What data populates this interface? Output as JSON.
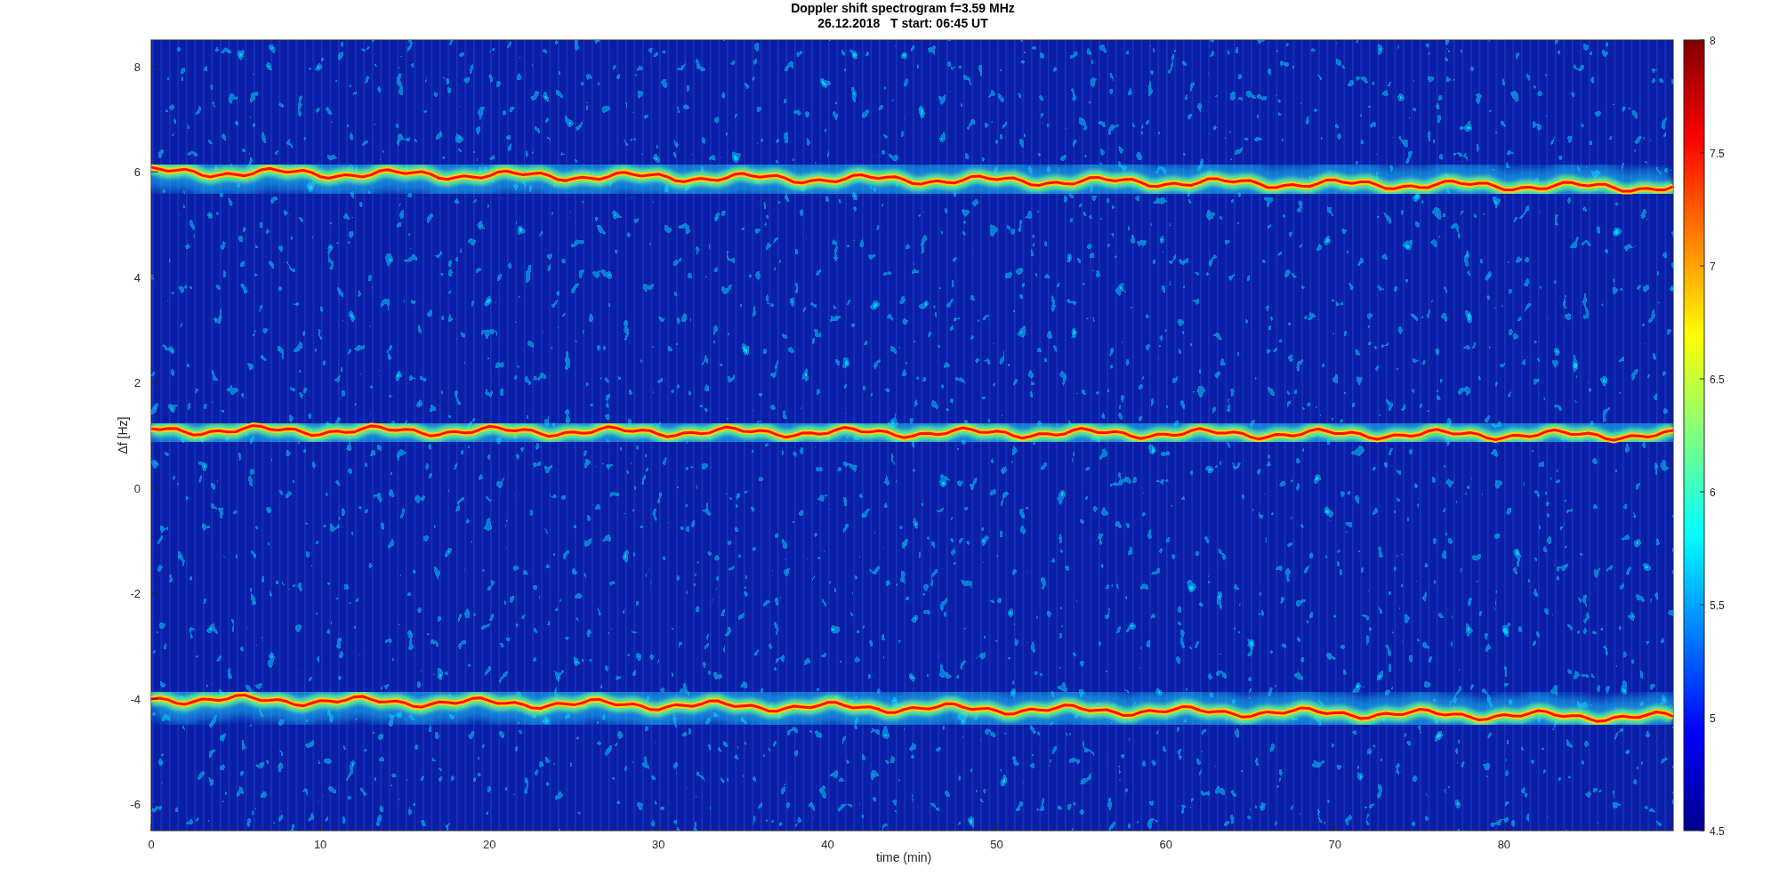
{
  "figure": {
    "title_lines": [
      "Doppler shift spectrogram f=3.59 MHz",
      "26.12.2018   T start: 06:45 UT"
    ]
  },
  "axes": {
    "xlabel": "time (min)",
    "ylabel": "Δf [Hz]",
    "xticks": [
      "0",
      "10",
      "20",
      "30",
      "40",
      "50",
      "60",
      "70",
      "80"
    ],
    "yticks": [
      "8",
      "6",
      "4",
      "2",
      "0",
      "-2",
      "-4",
      "-6"
    ]
  },
  "colorbar": {
    "ticks": [
      "8",
      "7.5",
      "7",
      "6.5",
      "6",
      "5.5",
      "5",
      "4.5"
    ]
  }
}
